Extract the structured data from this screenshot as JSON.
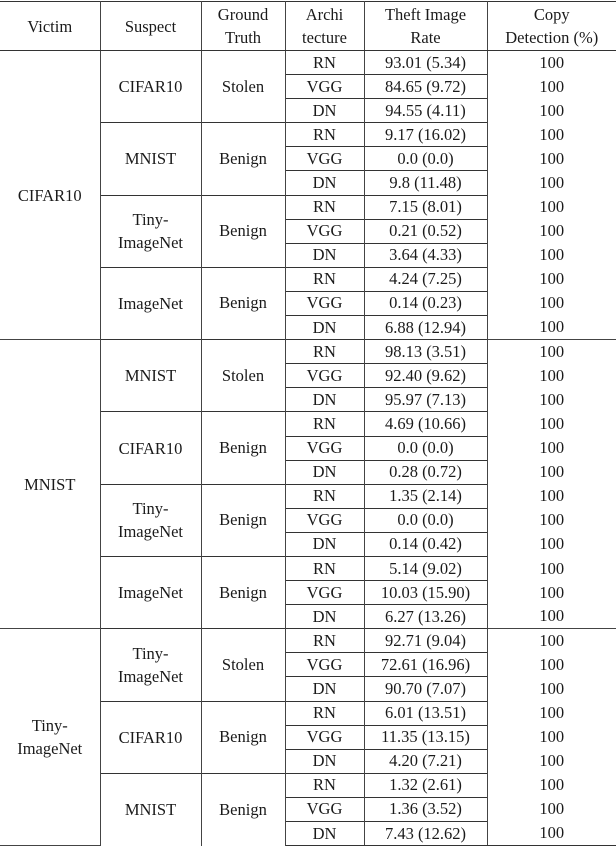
{
  "table": {
    "headers": {
      "victim": "Victim",
      "suspect": "Suspect",
      "ground_truth_line1": "Ground",
      "ground_truth_line2": "Truth",
      "architecture_line1": "Archi",
      "architecture_line2": "tecture",
      "theft_rate_line1": "Theft Image",
      "theft_rate_line2": "Rate",
      "copy_detection_line1": "Copy",
      "copy_detection_line2": "Detection (%)"
    },
    "victims": [
      {
        "victim": "CIFAR10",
        "suspects": [
          {
            "suspect": "CIFAR10",
            "ground_truth": "Stolen",
            "rows": [
              {
                "arch": "RN",
                "theft_rate": "93.01 (5.34)",
                "copy_detection": "100"
              },
              {
                "arch": "VGG",
                "theft_rate": "84.65 (9.72)",
                "copy_detection": "100"
              },
              {
                "arch": "DN",
                "theft_rate": "94.55 (4.11)",
                "copy_detection": "100"
              }
            ]
          },
          {
            "suspect": "MNIST",
            "ground_truth": "Benign",
            "rows": [
              {
                "arch": "RN",
                "theft_rate": "9.17 (16.02)",
                "copy_detection": "100"
              },
              {
                "arch": "VGG",
                "theft_rate": "0.0 (0.0)",
                "copy_detection": "100"
              },
              {
                "arch": "DN",
                "theft_rate": "9.8 (11.48)",
                "copy_detection": "100"
              }
            ]
          },
          {
            "suspect": "Tiny-ImageNet",
            "suspect_line1": "Tiny-",
            "suspect_line2": "ImageNet",
            "ground_truth": "Benign",
            "rows": [
              {
                "arch": "RN",
                "theft_rate": "7.15 (8.01)",
                "copy_detection": "100"
              },
              {
                "arch": "VGG",
                "theft_rate": "0.21 (0.52)",
                "copy_detection": "100"
              },
              {
                "arch": "DN",
                "theft_rate": "3.64 (4.33)",
                "copy_detection": "100"
              }
            ]
          },
          {
            "suspect": "ImageNet",
            "ground_truth": "Benign",
            "rows": [
              {
                "arch": "RN",
                "theft_rate": "4.24 (7.25)",
                "copy_detection": "100"
              },
              {
                "arch": "VGG",
                "theft_rate": "0.14 (0.23)",
                "copy_detection": "100"
              },
              {
                "arch": "DN",
                "theft_rate": "6.88 (12.94)",
                "copy_detection": "100"
              }
            ]
          }
        ]
      },
      {
        "victim": "MNIST",
        "suspects": [
          {
            "suspect": "MNIST",
            "ground_truth": "Stolen",
            "rows": [
              {
                "arch": "RN",
                "theft_rate": "98.13 (3.51)",
                "copy_detection": "100"
              },
              {
                "arch": "VGG",
                "theft_rate": "92.40 (9.62)",
                "copy_detection": "100"
              },
              {
                "arch": "DN",
                "theft_rate": "95.97 (7.13)",
                "copy_detection": "100"
              }
            ]
          },
          {
            "suspect": "CIFAR10",
            "ground_truth": "Benign",
            "rows": [
              {
                "arch": "RN",
                "theft_rate": "4.69 (10.66)",
                "copy_detection": "100"
              },
              {
                "arch": "VGG",
                "theft_rate": "0.0 (0.0)",
                "copy_detection": "100"
              },
              {
                "arch": "DN",
                "theft_rate": "0.28 (0.72)",
                "copy_detection": "100"
              }
            ]
          },
          {
            "suspect": "Tiny-ImageNet",
            "suspect_line1": "Tiny-",
            "suspect_line2": "ImageNet",
            "ground_truth": "Benign",
            "rows": [
              {
                "arch": "RN",
                "theft_rate": "1.35 (2.14)",
                "copy_detection": "100"
              },
              {
                "arch": "VGG",
                "theft_rate": "0.0 (0.0)",
                "copy_detection": "100"
              },
              {
                "arch": "DN",
                "theft_rate": "0.14 (0.42)",
                "copy_detection": "100"
              }
            ]
          },
          {
            "suspect": "ImageNet",
            "ground_truth": "Benign",
            "rows": [
              {
                "arch": "RN",
                "theft_rate": "5.14 (9.02)",
                "copy_detection": "100"
              },
              {
                "arch": "VGG",
                "theft_rate": "10.03 (15.90)",
                "copy_detection": "100"
              },
              {
                "arch": "DN",
                "theft_rate": "6.27 (13.26)",
                "copy_detection": "100"
              }
            ]
          }
        ]
      },
      {
        "victim": "Tiny-ImageNet",
        "victim_line1": "Tiny-",
        "victim_line2": "ImageNet",
        "suspects": [
          {
            "suspect": "Tiny-ImageNet",
            "suspect_line1": "Tiny-",
            "suspect_line2": "ImageNet",
            "ground_truth": "Stolen",
            "rows": [
              {
                "arch": "RN",
                "theft_rate": "92.71 (9.04)",
                "copy_detection": "100"
              },
              {
                "arch": "VGG",
                "theft_rate": "72.61 (16.96)",
                "copy_detection": "100"
              },
              {
                "arch": "DN",
                "theft_rate": "90.70 (7.07)",
                "copy_detection": "100"
              }
            ]
          },
          {
            "suspect": "CIFAR10",
            "ground_truth": "Benign",
            "rows": [
              {
                "arch": "RN",
                "theft_rate": "6.01 (13.51)",
                "copy_detection": "100"
              },
              {
                "arch": "VGG",
                "theft_rate": "11.35 (13.15)",
                "copy_detection": "100"
              },
              {
                "arch": "DN",
                "theft_rate": "4.20 (7.21)",
                "copy_detection": "100"
              }
            ]
          },
          {
            "suspect": "MNIST",
            "ground_truth": "Benign",
            "rows": [
              {
                "arch": "RN",
                "theft_rate": "1.32 (2.61)",
                "copy_detection": "100"
              },
              {
                "arch": "VGG",
                "theft_rate": "1.36 (3.52)",
                "copy_detection": "100"
              },
              {
                "arch": "DN",
                "theft_rate": "7.43 (12.62)",
                "copy_detection": "100"
              }
            ]
          }
        ]
      }
    ]
  }
}
